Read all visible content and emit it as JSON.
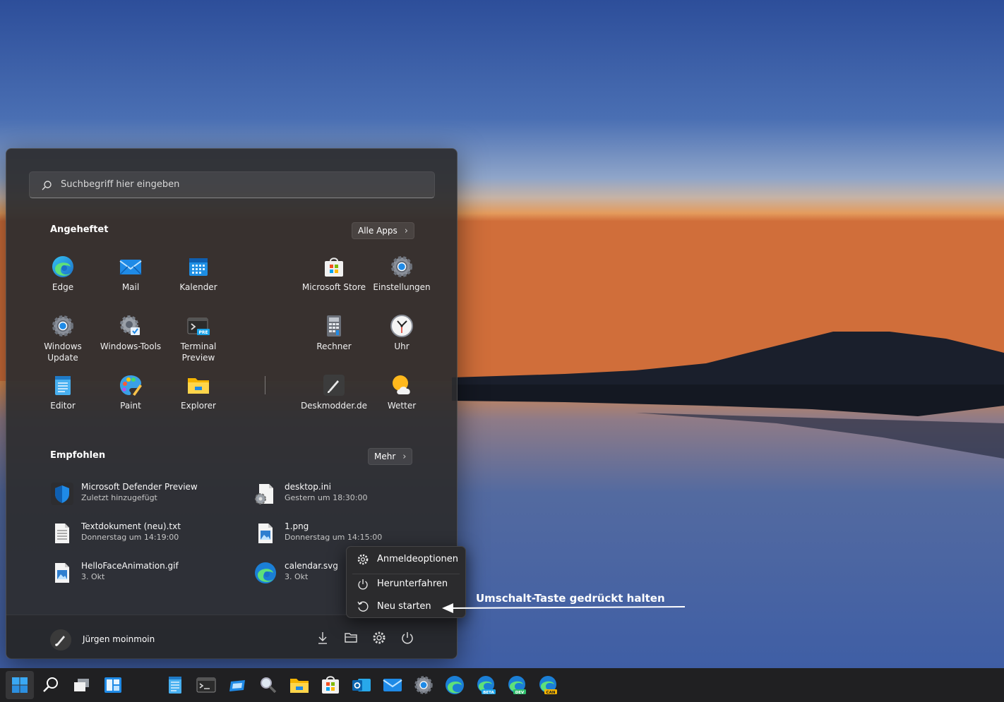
{
  "search": {
    "placeholder": "Suchbegriff hier eingeben"
  },
  "pinned": {
    "title": "Angeheftet",
    "all_apps_label": "Alle Apps",
    "apps": [
      {
        "label": "Edge",
        "icon": "edge-icon"
      },
      {
        "label": "Mail",
        "icon": "mail-icon"
      },
      {
        "label": "Kalender",
        "icon": "calendar-icon"
      },
      {
        "label": "Microsoft Store",
        "icon": "store-icon"
      },
      {
        "label": "Einstellungen",
        "icon": "settings-icon"
      },
      {
        "label": "Windows Update",
        "icon": "windows-update-icon"
      },
      {
        "label": "Windows-Tools",
        "icon": "windows-tools-icon"
      },
      {
        "label": "Terminal Preview",
        "icon": "terminal-preview-icon"
      },
      {
        "label": "Rechner",
        "icon": "calculator-icon"
      },
      {
        "label": "Uhr",
        "icon": "clock-icon"
      },
      {
        "label": "Editor",
        "icon": "notepad-icon"
      },
      {
        "label": "Paint",
        "icon": "paint-icon"
      },
      {
        "label": "Explorer",
        "icon": "folder-icon"
      },
      {
        "label": "Deskmodder.de",
        "icon": "deskmodder-icon"
      },
      {
        "label": "Wetter",
        "icon": "weather-icon"
      }
    ]
  },
  "recommended": {
    "title": "Empfohlen",
    "more_label": "Mehr",
    "items": [
      {
        "name": "Microsoft Defender Preview",
        "sub": "Zuletzt hinzugefügt",
        "icon": "defender-icon"
      },
      {
        "name": "desktop.ini",
        "sub": "Gestern um 18:30:00",
        "icon": "settings-file-icon"
      },
      {
        "name": "Textdokument (neu).txt",
        "sub": "Donnerstag um 14:19:00",
        "icon": "text-file-icon"
      },
      {
        "name": "1.png",
        "sub": "Donnerstag um 14:15:00",
        "icon": "image-file-icon"
      },
      {
        "name": "HelloFaceAnimation.gif",
        "sub": "3. Okt",
        "icon": "image-file-icon"
      },
      {
        "name": "calendar.svg",
        "sub": "3. Okt",
        "icon": "edge-icon"
      }
    ]
  },
  "footer": {
    "user_name": "Jürgen moinmoin"
  },
  "power_menu": {
    "items": [
      {
        "label": "Anmeldeoptionen",
        "icon": "gear-icon"
      },
      {
        "label": "Herunterfahren",
        "icon": "power-icon"
      },
      {
        "label": "Neu starten",
        "icon": "restart-icon"
      }
    ]
  },
  "annotation": {
    "text": "Umschalt-Taste gedrückt halten"
  },
  "taskbar": {
    "icons": [
      "windows-start-icon",
      "search-icon",
      "task-view-icon",
      "widgets-icon",
      "notepad-icon",
      "terminal-icon",
      "snipping-icon",
      "magnifier-icon",
      "folder-icon",
      "store-icon",
      "outlook-icon",
      "mail-icon",
      "settings-icon",
      "edge-icon",
      "edge-beta-icon",
      "edge-dev-icon",
      "edge-canary-icon"
    ],
    "badges": {
      "beta": "BETA",
      "dev": "DEV",
      "canary": "CAN"
    }
  },
  "colors": {
    "accent": "#0078d4",
    "menu_bg": "#2c2c2e",
    "taskbar_bg": "#202022"
  }
}
